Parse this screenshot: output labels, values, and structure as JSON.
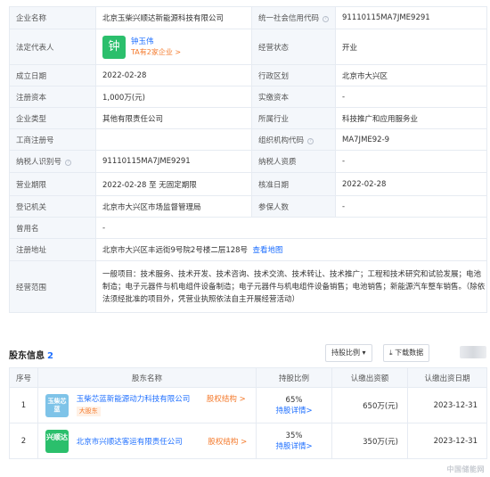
{
  "info": {
    "company_name_label": "企业名称",
    "company_name": "北京玉柴兴顺达新能源科技有限公司",
    "credit_code_label": "统一社会信用代码",
    "credit_code": "91110115MA7JME9291",
    "legal_rep_label": "法定代表人",
    "legal_rep_avatar": "钟",
    "legal_rep_name": "钟玉伟",
    "legal_rep_sub": "TA有2家企业 >",
    "status_label": "经营状态",
    "status": "开业",
    "est_date_label": "成立日期",
    "est_date": "2022-02-28",
    "district_label": "行政区划",
    "district": "北京市大兴区",
    "reg_capital_label": "注册资本",
    "reg_capital": "1,000万(元)",
    "paid_capital_label": "实缴资本",
    "paid_capital": "-",
    "type_label": "企业类型",
    "type": "其他有限责任公司",
    "industry_label": "所属行业",
    "industry": "科技推广和应用服务业",
    "biz_reg_no_label": "工商注册号",
    "biz_reg_no": "",
    "org_code_label": "组织机构代码",
    "org_code": "MA7JME92-9",
    "taxpayer_id_label": "纳税人识别号",
    "taxpayer_id": "91110115MA7JME9291",
    "taxpayer_qual_label": "纳税人资质",
    "taxpayer_qual": "-",
    "term_label": "营业期限",
    "term": "2022-02-28 至 无固定期限",
    "approval_date_label": "核准日期",
    "approval_date": "2022-02-28",
    "authority_label": "登记机关",
    "authority": "北京市大兴区市场监督管理局",
    "insured_label": "参保人数",
    "insured": "-",
    "former_name_label": "曾用名",
    "former_name": "-",
    "address_label": "注册地址",
    "address": "北京市大兴区丰远街9号院2号楼二层128号",
    "address_link": "查看地图",
    "scope_label": "经营范围",
    "scope": "一般项目：技术服务、技术开发、技术咨询、技术交流、技术转让、技术推广；工程和技术研究和试验发展；电池制造；电子元器件与机电组件设备制造；电子元器件与机电组件设备销售；电池销售；新能源汽车整车销售。（除依法须经批准的项目外，凭营业执照依法自主开展经营活动）"
  },
  "shareholders": {
    "title": "股东信息",
    "count": "2",
    "sort_button": "持股比例 ▾",
    "download_button": "下载数据",
    "headers": [
      "序号",
      "股东名称",
      "持股比例",
      "认缴出资额",
      "认缴出资日期"
    ],
    "rows": [
      {
        "index": "1",
        "logo_text": "玉柴芯蓝",
        "logo_color": "#7ec3e8",
        "name": "玉柴芯蓝新能源动力科技有限公司",
        "tag": "大股东",
        "equity_link": "股权结构 >",
        "ratio": "65%",
        "detail_link": "持股详情>",
        "amount": "650万(元)",
        "date": "2023-12-31"
      },
      {
        "index": "2",
        "logo_text": "兴顺达",
        "logo_color": "#2bbf6c",
        "name": "北京市兴顺达客运有限责任公司",
        "tag": "",
        "equity_link": "股权结构 >",
        "ratio": "35%",
        "detail_link": "持股详情>",
        "amount": "350万(元)",
        "date": "2023-12-31"
      }
    ]
  },
  "watermark": "中国储能网",
  "colors": {
    "link": "#1e6fff",
    "accent_orange": "#f47a2c",
    "label_bg": "#f4f7fb"
  }
}
